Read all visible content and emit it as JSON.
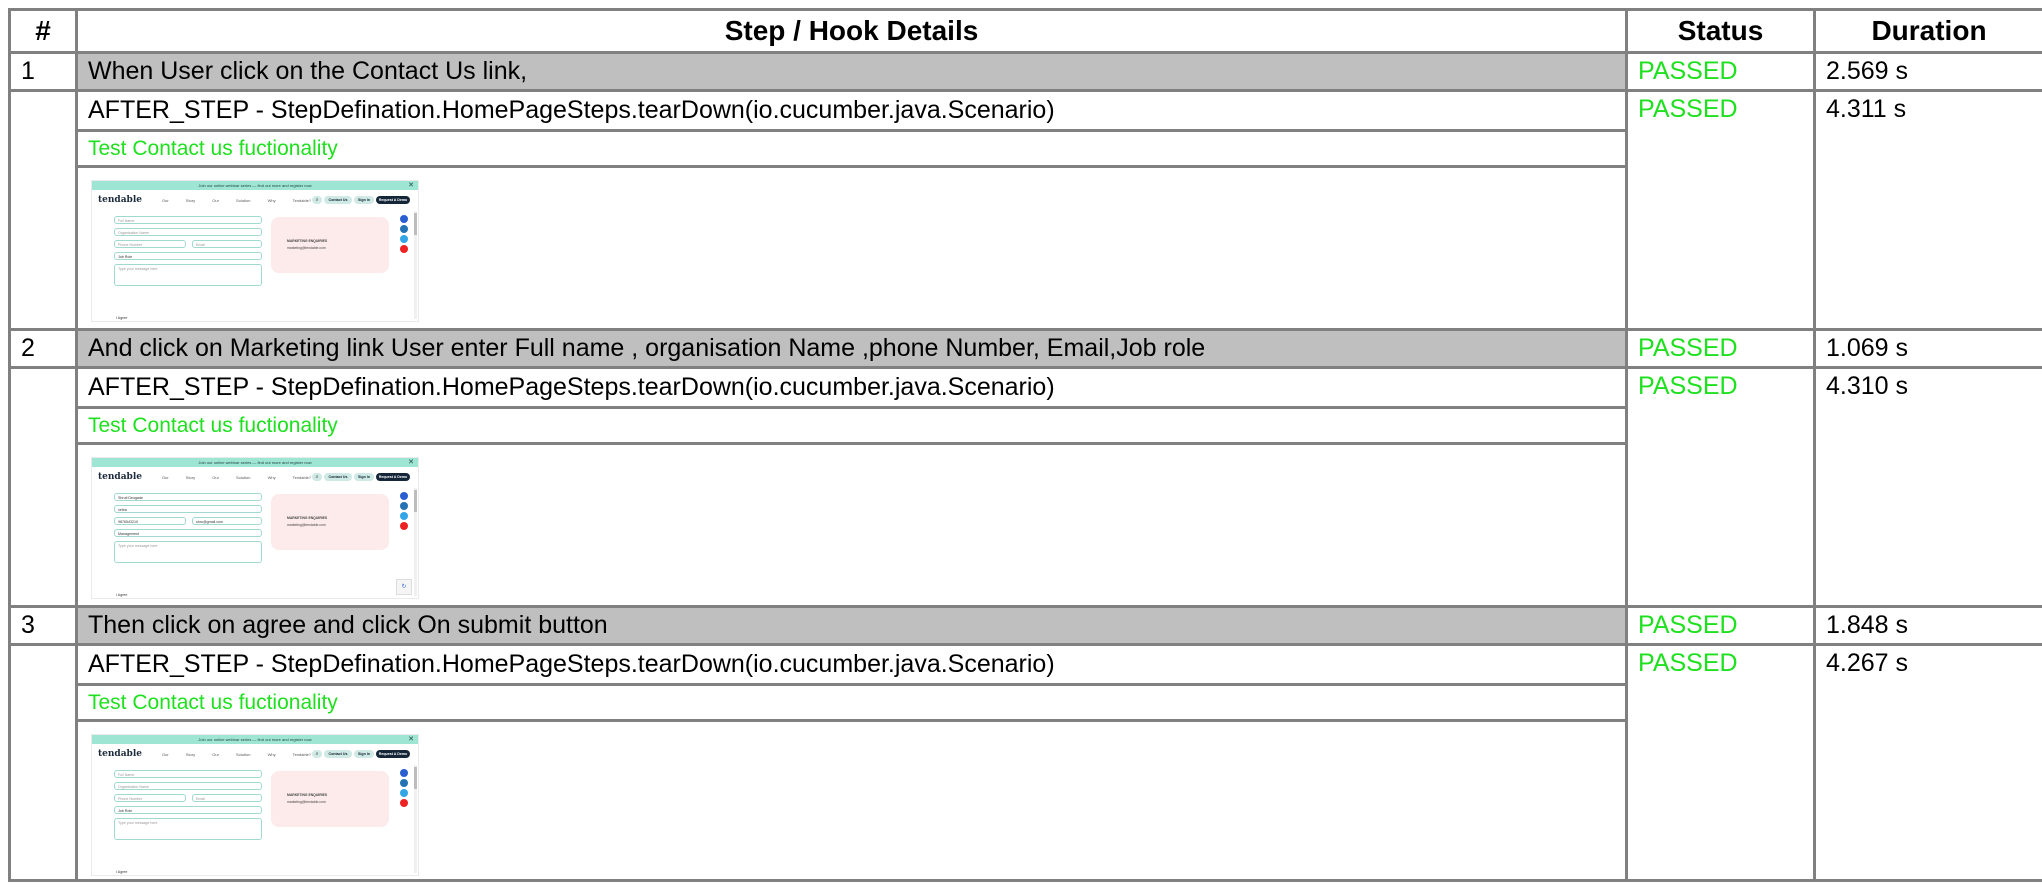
{
  "headers": {
    "num": "#",
    "details": "Step / Hook Details",
    "status": "Status",
    "duration": "Duration"
  },
  "thumb": {
    "banner": "Join our online webinar series — find out more and register now",
    "logo": "tendable",
    "nav": "Our Story Our Solution Why Tendable? About Us",
    "contact": "Contact Us",
    "signin": "Sign In",
    "demo": "Request A Demo",
    "card_title": "MARKETING ENQUIRIES",
    "card_email": "marketing@tendable.com",
    "agree": "I Agree",
    "ph_fullname": "Full Name",
    "ph_org": "Organisation Name",
    "ph_phone": "Phone Number",
    "ph_email": "Email",
    "ph_job": "Job Role",
    "ph_message": "Type your message here",
    "filled_fullname": "Shruti Deogade",
    "filled_org": "xeltra",
    "filled_phone": "9876543210",
    "filled_email": "shru@gmail.com",
    "filled_job": "Management"
  },
  "colors": {
    "passed": "#1fe01f",
    "step_bg": "#bfbfbf",
    "border": "#808080"
  },
  "steps": [
    {
      "num": "1",
      "text": "When User click on the Contact Us link,",
      "status": "PASSED",
      "duration": "2.569 s",
      "hook": {
        "text": "AFTER_STEP - StepDefination.HomePageSteps.tearDown(io.cucumber.java.Scenario)",
        "status": "PASSED",
        "duration": "4.311 s",
        "sub": "Test Contact us fuctionality"
      }
    },
    {
      "num": "2",
      "text": "And click on Marketing link User enter Full name , organisation Name ,phone Number, Email,Job role",
      "status": "PASSED",
      "duration": "1.069 s",
      "hook": {
        "text": "AFTER_STEP - StepDefination.HomePageSteps.tearDown(io.cucumber.java.Scenario)",
        "status": "PASSED",
        "duration": "4.310 s",
        "sub": "Test Contact us fuctionality"
      }
    },
    {
      "num": "3",
      "text": "Then click on agree and click On submit button",
      "status": "PASSED",
      "duration": "1.848 s",
      "hook": {
        "text": "AFTER_STEP - StepDefination.HomePageSteps.tearDown(io.cucumber.java.Scenario)",
        "status": "PASSED",
        "duration": "4.267 s",
        "sub": "Test Contact us fuctionality"
      }
    }
  ]
}
